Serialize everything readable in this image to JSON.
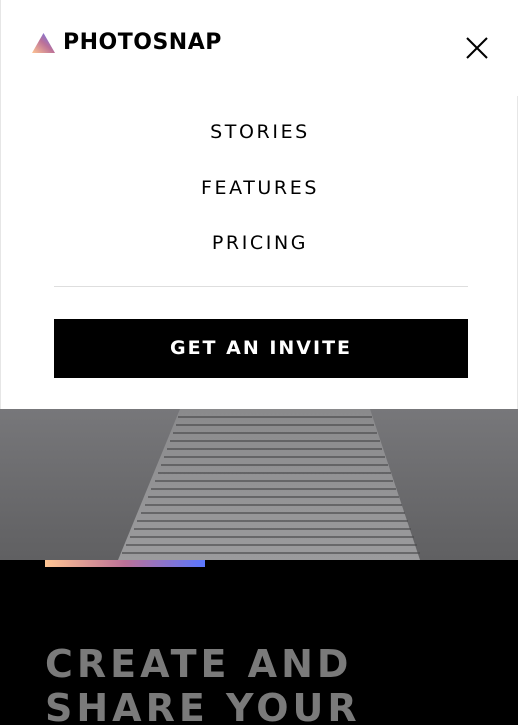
{
  "header": {
    "brand": "PHOTOSNAP",
    "logo_icon": "triangle-gradient-logo-icon",
    "close_icon": "close-icon"
  },
  "nav": {
    "items": [
      {
        "label": "STORIES"
      },
      {
        "label": "FEATURES"
      },
      {
        "label": "PRICING"
      }
    ]
  },
  "cta": {
    "label": "GET AN INVITE"
  },
  "hero": {
    "title_line1": "CREATE AND",
    "title_line2": "SHARE YOUR",
    "accent_gradient": [
      "#ffc593",
      "#bc7198",
      "#5a77ff"
    ]
  },
  "colors": {
    "text": "#000000",
    "background": "#ffffff",
    "hero_dark": "#000000",
    "hero_title": "#7a7a7a"
  }
}
